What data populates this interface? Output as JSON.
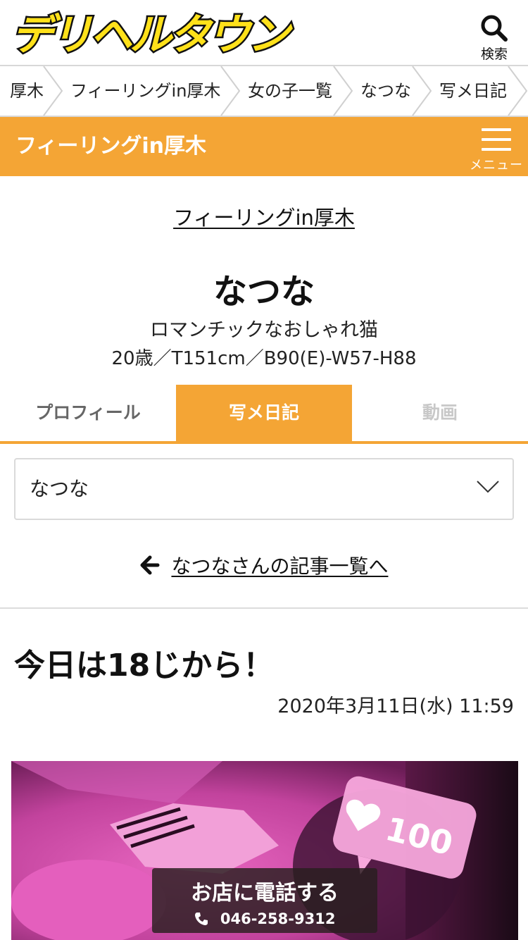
{
  "header": {
    "logo_text": "デリヘルタウン",
    "search_label": "検索"
  },
  "breadcrumb": [
    {
      "label": "厚木"
    },
    {
      "label": "フィーリングin厚木"
    },
    {
      "label": "女の子一覧"
    },
    {
      "label": "なつな"
    },
    {
      "label": "写メ日記"
    }
  ],
  "shop_bar": {
    "title": "フィーリングin厚木",
    "menu_label": "メニュー"
  },
  "profile": {
    "shop_link": "フィーリングin厚木",
    "name": "なつな",
    "catchphrase": "ロマンチックなおしゃれ猫",
    "spec": "20歳／T151cm／B90(E)-W57-H88"
  },
  "tabs": [
    {
      "label": "プロフィール",
      "active": false
    },
    {
      "label": "写メ日記",
      "active": true
    },
    {
      "label": "動画",
      "active": false
    }
  ],
  "select": {
    "value": "なつな"
  },
  "back_link": "なつなさんの記事一覧へ",
  "post": {
    "title": "今日は18じから！",
    "date": "2020年3月11日(水) 11:59",
    "photo_badge": "100"
  },
  "call": {
    "label": "お店に電話する",
    "phone": "046-258-9312"
  },
  "colors": {
    "accent": "#f4a535",
    "logo_yellow": "#ffe11a"
  }
}
